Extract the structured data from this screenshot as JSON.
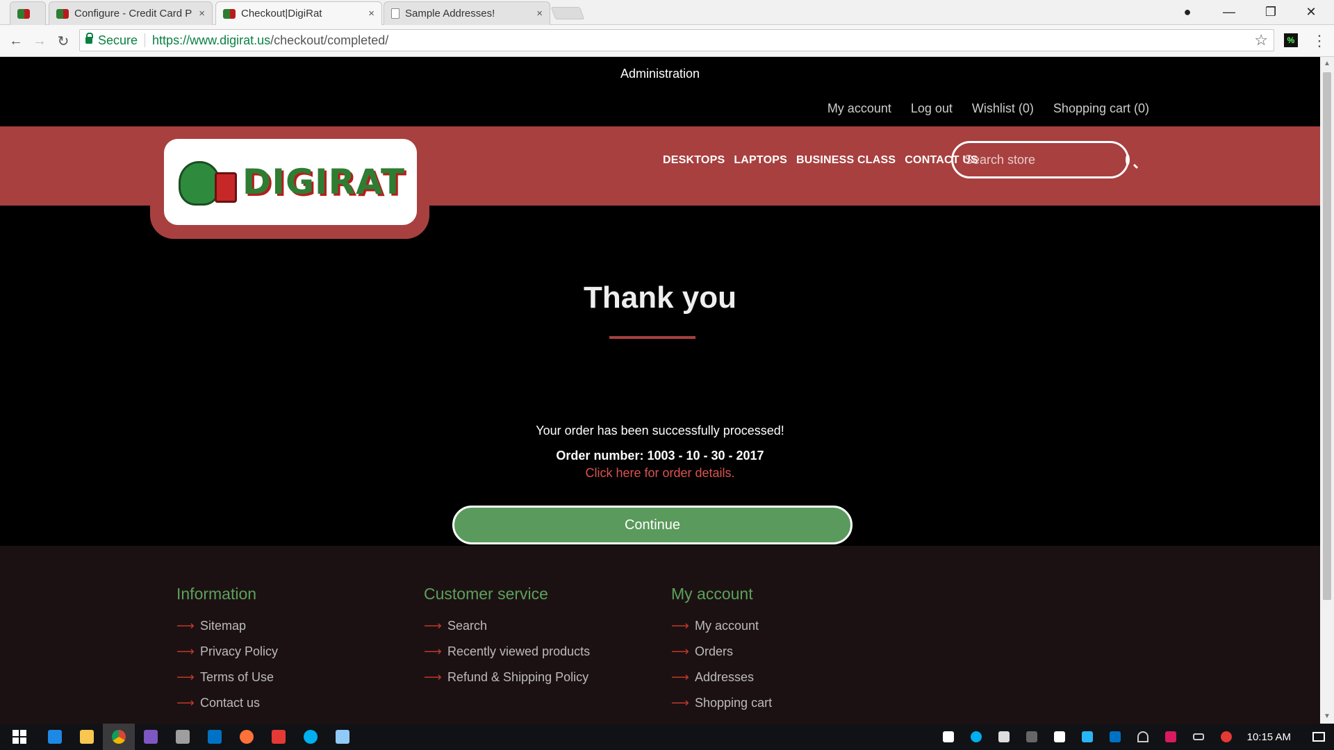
{
  "browser": {
    "tabs": [
      {
        "title": "Configure - Credit Card P",
        "close": "×",
        "icon": "digirat-favicon-icon",
        "active": false
      },
      {
        "title": "Checkout|DigiRat",
        "close": "×",
        "icon": "digirat-favicon-icon",
        "active": true
      },
      {
        "title": "Sample Addresses!",
        "close": "×",
        "icon": "document-icon",
        "active": false
      }
    ],
    "window_controls": {
      "profile": "●",
      "minimize": "—",
      "maximize": "❐",
      "close": "✕"
    },
    "nav": {
      "back": "←",
      "forward": "→",
      "reload": "↻"
    },
    "secure_label": "Secure",
    "url_host": "https://www.digirat.us",
    "url_path": "/checkout/completed/",
    "bookmark": "☆",
    "extension_label": "%",
    "menu": "⋮"
  },
  "header": {
    "administration": "Administration",
    "links": [
      "My account",
      "Log out",
      "Wishlist (0)",
      "Shopping cart (0)"
    ],
    "logo_text": "DIGIRAT",
    "nav": [
      "DESKTOPS",
      "LAPTOPS",
      "BUSINESS CLASS",
      "CONTACT US"
    ],
    "search_placeholder": "Search store"
  },
  "main": {
    "title": "Thank you",
    "success_message": "Your order has been successfully processed!",
    "order_number": "Order number: 1003 - 10 - 30 - 2017",
    "details_link": "Click here for order details.",
    "continue_label": "Continue"
  },
  "footer": {
    "arrow": "⟶",
    "columns": [
      {
        "title": "Information",
        "items": [
          "Sitemap",
          "Privacy Policy",
          "Terms of Use",
          "Contact us"
        ]
      },
      {
        "title": "Customer service",
        "items": [
          "Search",
          "Recently viewed products",
          "Refund & Shipping Policy"
        ]
      },
      {
        "title": "My account",
        "items": [
          "My account",
          "Orders",
          "Addresses",
          "Shopping cart"
        ]
      }
    ]
  },
  "taskbar": {
    "clock": "10:15 AM"
  },
  "colors": {
    "brand_red": "#a8403f",
    "brand_green": "#5aa15c",
    "button_green": "#5a9a5c",
    "link_red": "#d9534f"
  }
}
